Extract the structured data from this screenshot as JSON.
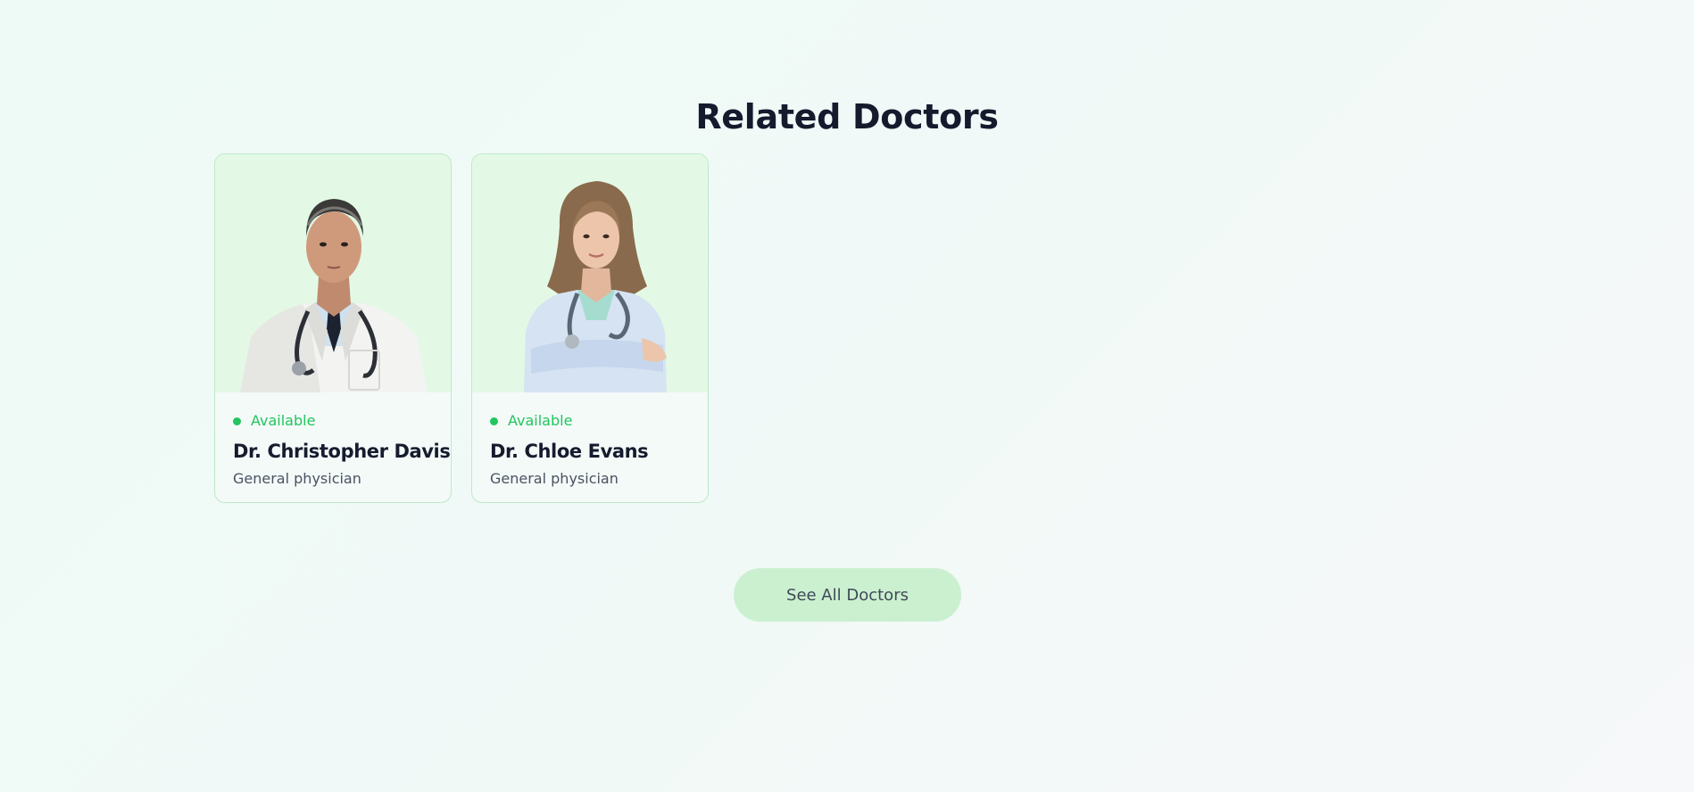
{
  "section": {
    "title": "Related Doctors"
  },
  "doctors": [
    {
      "status": "Available",
      "name": "Dr. Christopher Davis",
      "speciality": "General physician"
    },
    {
      "status": "Available",
      "name": "Dr. Chloe Evans",
      "speciality": "General physician"
    }
  ],
  "actions": {
    "see_all_label": "See All Doctors"
  },
  "colors": {
    "accent_green": "#22c55e",
    "card_photo_bg": "#e3f9e6",
    "button_bg": "#cbf0d0",
    "heading": "#151a2d"
  }
}
